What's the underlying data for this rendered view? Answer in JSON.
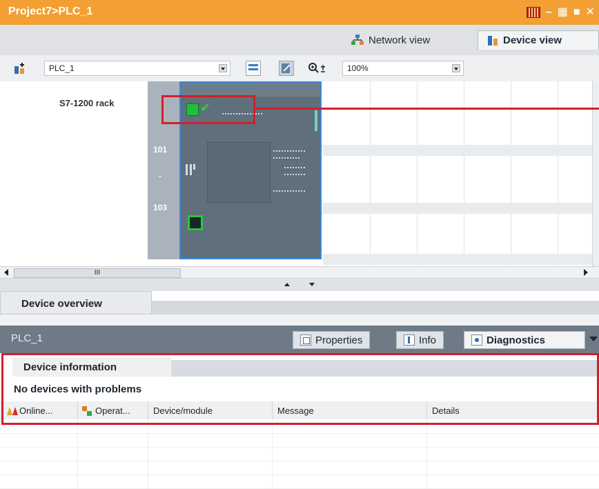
{
  "window": {
    "title": "Project7>PLC_1",
    "controls": [
      "minimize-icon",
      "restore-icon",
      "maximize-icon",
      "close-icon"
    ]
  },
  "view_tabs": [
    {
      "label": "Network view",
      "icon": "network-icon",
      "active": false
    },
    {
      "label": "Device view",
      "icon": "device-icon",
      "active": true
    }
  ],
  "toolbar": {
    "device": "PLC_1",
    "zoom": "100%"
  },
  "canvas": {
    "rack_label": "S7-1200 rack",
    "slots": [
      "101",
      "-",
      "103"
    ],
    "plc_status": "ok"
  },
  "scrollbar": {
    "label": "III"
  },
  "device_overview": {
    "label": "Device overview"
  },
  "inspector": {
    "title": "PLC_1",
    "tabs": [
      {
        "label": "Properties",
        "icon": "properties-icon"
      },
      {
        "label": "Info",
        "icon": "info-icon"
      },
      {
        "label": "Diagnostics",
        "icon": "diagnostics-icon",
        "active": true
      }
    ]
  },
  "diagnostics": {
    "tab": "Device information",
    "status_text": "No devices with problems",
    "columns": [
      "Online...",
      "Operat...",
      "Device/module",
      "Message",
      "Details"
    ],
    "rows": []
  },
  "colors": {
    "title_bar": "#f2a033",
    "highlight": "#d11f2a",
    "status_ok": "#22c03a"
  }
}
